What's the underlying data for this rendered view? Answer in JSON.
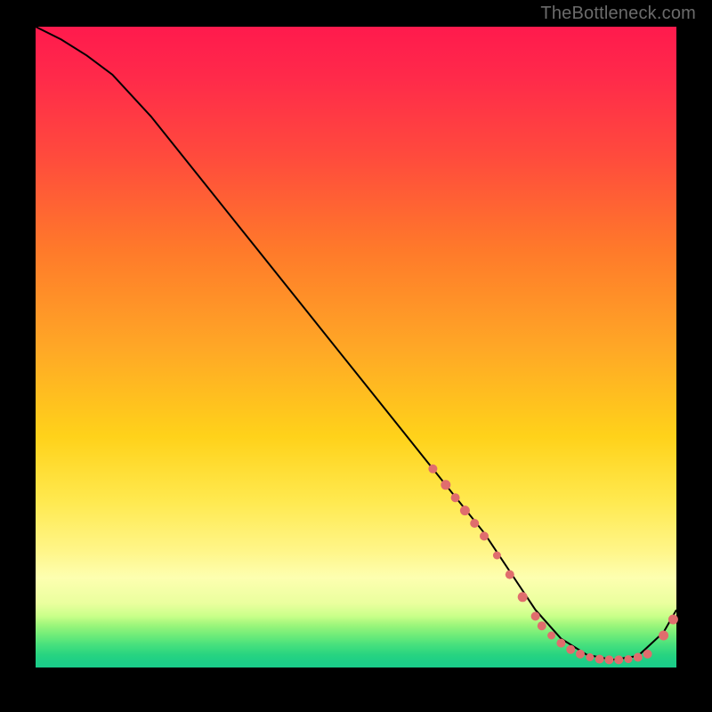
{
  "attribution": "TheBottleneck.com",
  "chart_data": {
    "type": "line",
    "title": "",
    "xlabel": "",
    "ylabel": "",
    "xlim": [
      0,
      100
    ],
    "ylim": [
      0,
      100
    ],
    "series": [
      {
        "name": "curve",
        "x": [
          0,
          4,
          8,
          12,
          18,
          26,
          34,
          42,
          50,
          58,
          66,
          70,
          74,
          78,
          82,
          86,
          90,
          94,
          98,
          100
        ],
        "y": [
          100,
          98,
          95.5,
          92.5,
          86,
          76,
          66,
          56,
          46,
          36,
          26,
          21,
          15,
          9,
          4.5,
          2,
          1.2,
          1.8,
          5.5,
          9
        ]
      }
    ],
    "points": {
      "name": "markers",
      "x": [
        62,
        64,
        65.5,
        67,
        68.5,
        70,
        72,
        74,
        76,
        78,
        79,
        80.5,
        82,
        83.5,
        85,
        86.5,
        88,
        89.5,
        91,
        92.5,
        94,
        95.5,
        98,
        99.5
      ],
      "y": [
        31,
        28.5,
        26.5,
        24.5,
        22.5,
        20.5,
        17.5,
        14.5,
        11,
        8,
        6.5,
        5,
        3.8,
        2.8,
        2.1,
        1.6,
        1.3,
        1.2,
        1.2,
        1.3,
        1.6,
        2.1,
        5,
        7.5
      ],
      "r": [
        5,
        5.5,
        5,
        5.5,
        5,
        5,
        4.5,
        5,
        5.5,
        5,
        5,
        4.5,
        5,
        5,
        5,
        4.5,
        5,
        5,
        5,
        4.5,
        5,
        5,
        5.5,
        5.5
      ]
    },
    "gradient_stops": [
      {
        "pos": 0,
        "color": "#ff1a4d"
      },
      {
        "pos": 50,
        "color": "#ffa726"
      },
      {
        "pos": 82,
        "color": "#fff68a"
      },
      {
        "pos": 100,
        "color": "#1acc8a"
      }
    ]
  }
}
